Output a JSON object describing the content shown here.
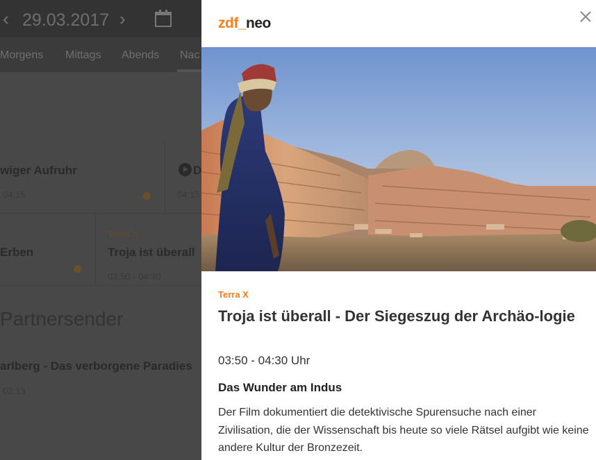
{
  "background": {
    "date": "29.03.2017",
    "tabs": [
      "Morgens",
      "Mittags",
      "Abends",
      "Nac"
    ],
    "cards": [
      {
        "title": "wiger Aufruhr",
        "time": "04:15"
      },
      {
        "title": "D",
        "time": "04:15"
      },
      {
        "title": "Erben",
        "time": ""
      },
      {
        "genre": "Terra X",
        "title": "Troja ist überall",
        "time": "03:50 - 04:30"
      },
      {
        "title": "arlberg - Das verborgene Paradies",
        "time": "02:13"
      }
    ],
    "section_title": "Partnersender"
  },
  "panel": {
    "logo_zdf": "zdf_",
    "logo_neo": "neo",
    "genre": "Terra X",
    "title": "Troja ist überall - Der Siegeszug der Archäo-logie",
    "time": "03:50 - 04:30 Uhr",
    "subtitle": "Das Wunder am Indus",
    "description": "Der Film dokumentiert die detektivische Spurensuche nach einer Zivilisation, die der Wissenschaft bis heute so viele Rätsel aufgibt wie keine andere Kultur der Bronzezeit."
  },
  "colors": {
    "accent": "#fa7d19",
    "overlay": "#484848"
  },
  "icons": {
    "prev": "chevron-left-icon",
    "next": "chevron-right-icon",
    "calendar": "calendar-icon",
    "close": "close-icon",
    "play": "play-icon"
  }
}
